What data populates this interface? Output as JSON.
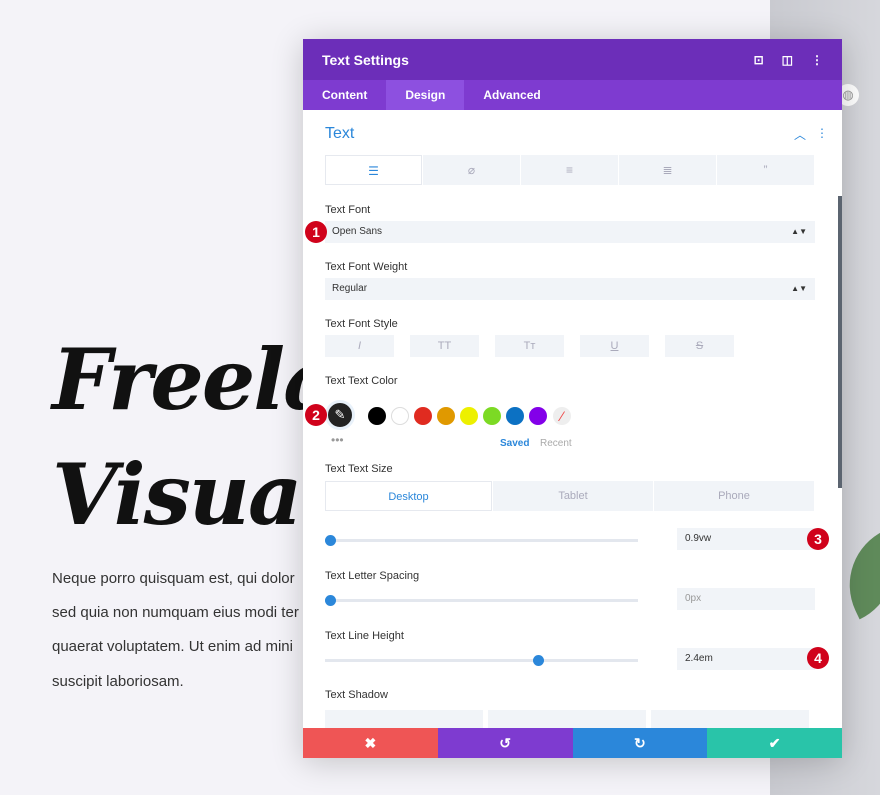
{
  "page": {
    "hero_line1": "Freelan",
    "hero_line2": "Visual A",
    "paragraph": [
      "Neque porro quisquam est, qui dolor",
      "sed quia non numquam eius modi ter",
      "quaerat voluptatem. Ut enim ad mini",
      "suscipit laboriosam."
    ]
  },
  "modal": {
    "title": "Text Settings",
    "tabs": [
      "Content",
      "Design",
      "Advanced"
    ],
    "active_tab": "Design",
    "section": "Text",
    "text_font_label": "Text Font",
    "text_font": "Open Sans",
    "weight_label": "Text Font Weight",
    "weight": "Regular",
    "style_label": "Text Font Style",
    "color_label": "Text Text Color",
    "saved": "Saved",
    "recent": "Recent",
    "swatches": [
      "#000000",
      "#ffffff",
      "#e02b20",
      "#e09900",
      "#edf000",
      "#7cda24",
      "#0c71c3",
      "#8300e9"
    ],
    "size_label": "Text Text Size",
    "devices": [
      "Desktop",
      "Tablet",
      "Phone"
    ],
    "size": "0.9vw",
    "size_pct": 0,
    "spacing_label": "Text Letter Spacing",
    "spacing": "0px",
    "spacing_pct": 0,
    "lineheight_label": "Text Line Height",
    "lineheight": "2.4em",
    "lineheight_pct": 69,
    "shadow_label": "Text Shadow",
    "badges": [
      "1",
      "2",
      "3",
      "4"
    ]
  },
  "footer": {
    "cancel": "✖",
    "undo": "↺",
    "redo": "↻",
    "save": "✔",
    "colors": [
      "#ef5555",
      "#7e3bd0",
      "#2b87da",
      "#29c4a9"
    ]
  }
}
